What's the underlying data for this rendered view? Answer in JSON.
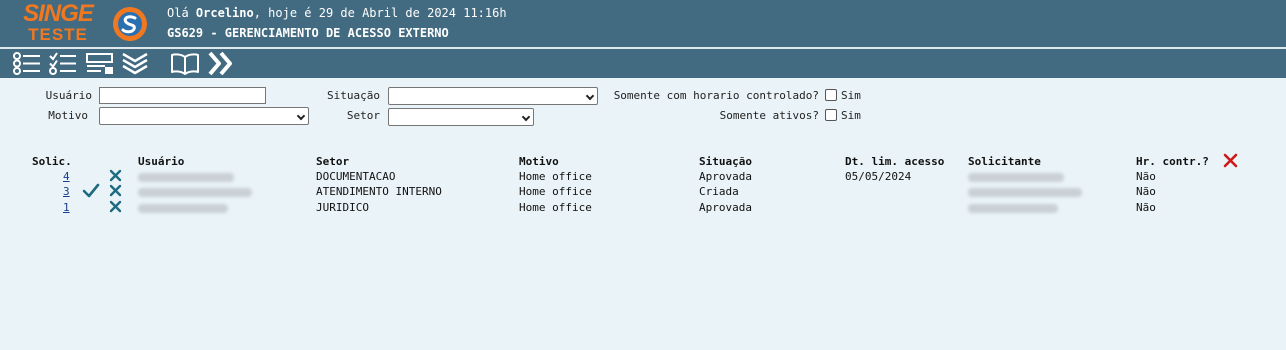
{
  "header": {
    "logo_line1": "SINGE",
    "logo_line2": "TESTE",
    "greeting_prefix": "Olá ",
    "user_name": "Orcelino",
    "greeting_suffix": ", hoje é 29 de Abril de 2024 11:16h",
    "page_title": "GS629 - GERENCIAMENTO DE ACESSO EXTERNO"
  },
  "toolbar": {
    "icons": [
      "list-icon",
      "checklist-icon",
      "form-icon",
      "collapse-icon",
      "book-icon",
      "forward-icon"
    ]
  },
  "filters": {
    "usuario_label": "Usuário",
    "usuario_value": "",
    "motivo_label": "Motivo",
    "motivo_value": "",
    "situacao_label": "Situação",
    "situacao_value": "",
    "setor_label": "Setor",
    "setor_value": "",
    "horario_label": "Somente com horario controlado?",
    "horario_option": "Sim",
    "ativos_label": "Somente ativos?",
    "ativos_option": "Sim"
  },
  "table": {
    "headers": {
      "solic": "Solic.",
      "usuario": "Usuário",
      "setor": "Setor",
      "motivo": "Motivo",
      "situacao": "Situação",
      "dt_lim": "Dt. lim. acesso",
      "solicitante": "Solicitante",
      "hr_contr": "Hr. contr.?"
    },
    "rows": [
      {
        "solic": "4",
        "setor": "DOCUMENTACAO",
        "motivo": "Home office",
        "situacao": "Aprovada",
        "dt_lim": "05/05/2024",
        "hr_contr": "Não"
      },
      {
        "solic": "3",
        "setor": "ATENDIMENTO INTERNO",
        "motivo": "Home office",
        "situacao": "Criada",
        "dt_lim": "",
        "hr_contr": "Não"
      },
      {
        "solic": "1",
        "setor": "JURIDICO",
        "motivo": "Home office",
        "situacao": "Aprovada",
        "dt_lim": "",
        "hr_contr": "Não"
      }
    ]
  },
  "colors": {
    "header_bg": "#426a80",
    "body_bg": "#eaf4f8",
    "logo_orange": "#f07820",
    "action_teal": "#1e6a80",
    "delete_red": "#d01818"
  }
}
